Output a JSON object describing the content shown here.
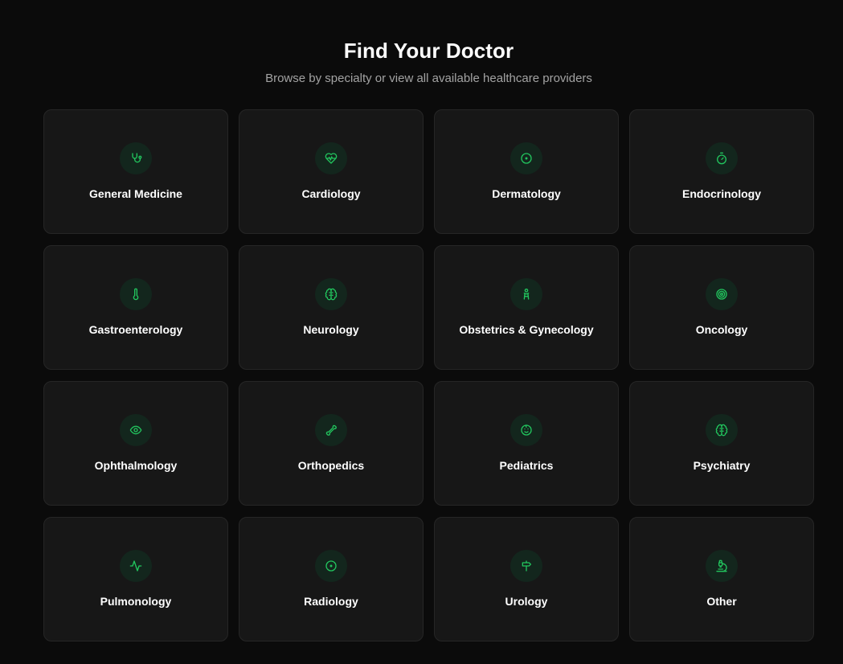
{
  "header": {
    "title": "Find Your Doctor",
    "subtitle": "Browse by specialty or view all available healthcare providers"
  },
  "colors": {
    "background": "#0b0b0b",
    "card": "#171717",
    "accent": "#22c55e"
  },
  "specialties": [
    {
      "label": "General Medicine",
      "icon": "stethoscope-icon"
    },
    {
      "label": "Cardiology",
      "icon": "heart-pulse-icon"
    },
    {
      "label": "Dermatology",
      "icon": "circle-dot-icon"
    },
    {
      "label": "Endocrinology",
      "icon": "timer-icon"
    },
    {
      "label": "Gastroenterology",
      "icon": "thermometer-icon"
    },
    {
      "label": "Neurology",
      "icon": "brain-icon"
    },
    {
      "label": "Obstetrics & Gynecology",
      "icon": "baby-icon"
    },
    {
      "label": "Oncology",
      "icon": "target-icon"
    },
    {
      "label": "Ophthalmology",
      "icon": "eye-icon"
    },
    {
      "label": "Orthopedics",
      "icon": "bone-icon"
    },
    {
      "label": "Pediatrics",
      "icon": "smile-icon"
    },
    {
      "label": "Psychiatry",
      "icon": "brain-icon"
    },
    {
      "label": "Pulmonology",
      "icon": "activity-icon"
    },
    {
      "label": "Radiology",
      "icon": "circle-dot-icon"
    },
    {
      "label": "Urology",
      "icon": "signpost-icon"
    },
    {
      "label": "Other",
      "icon": "microscope-icon"
    }
  ]
}
